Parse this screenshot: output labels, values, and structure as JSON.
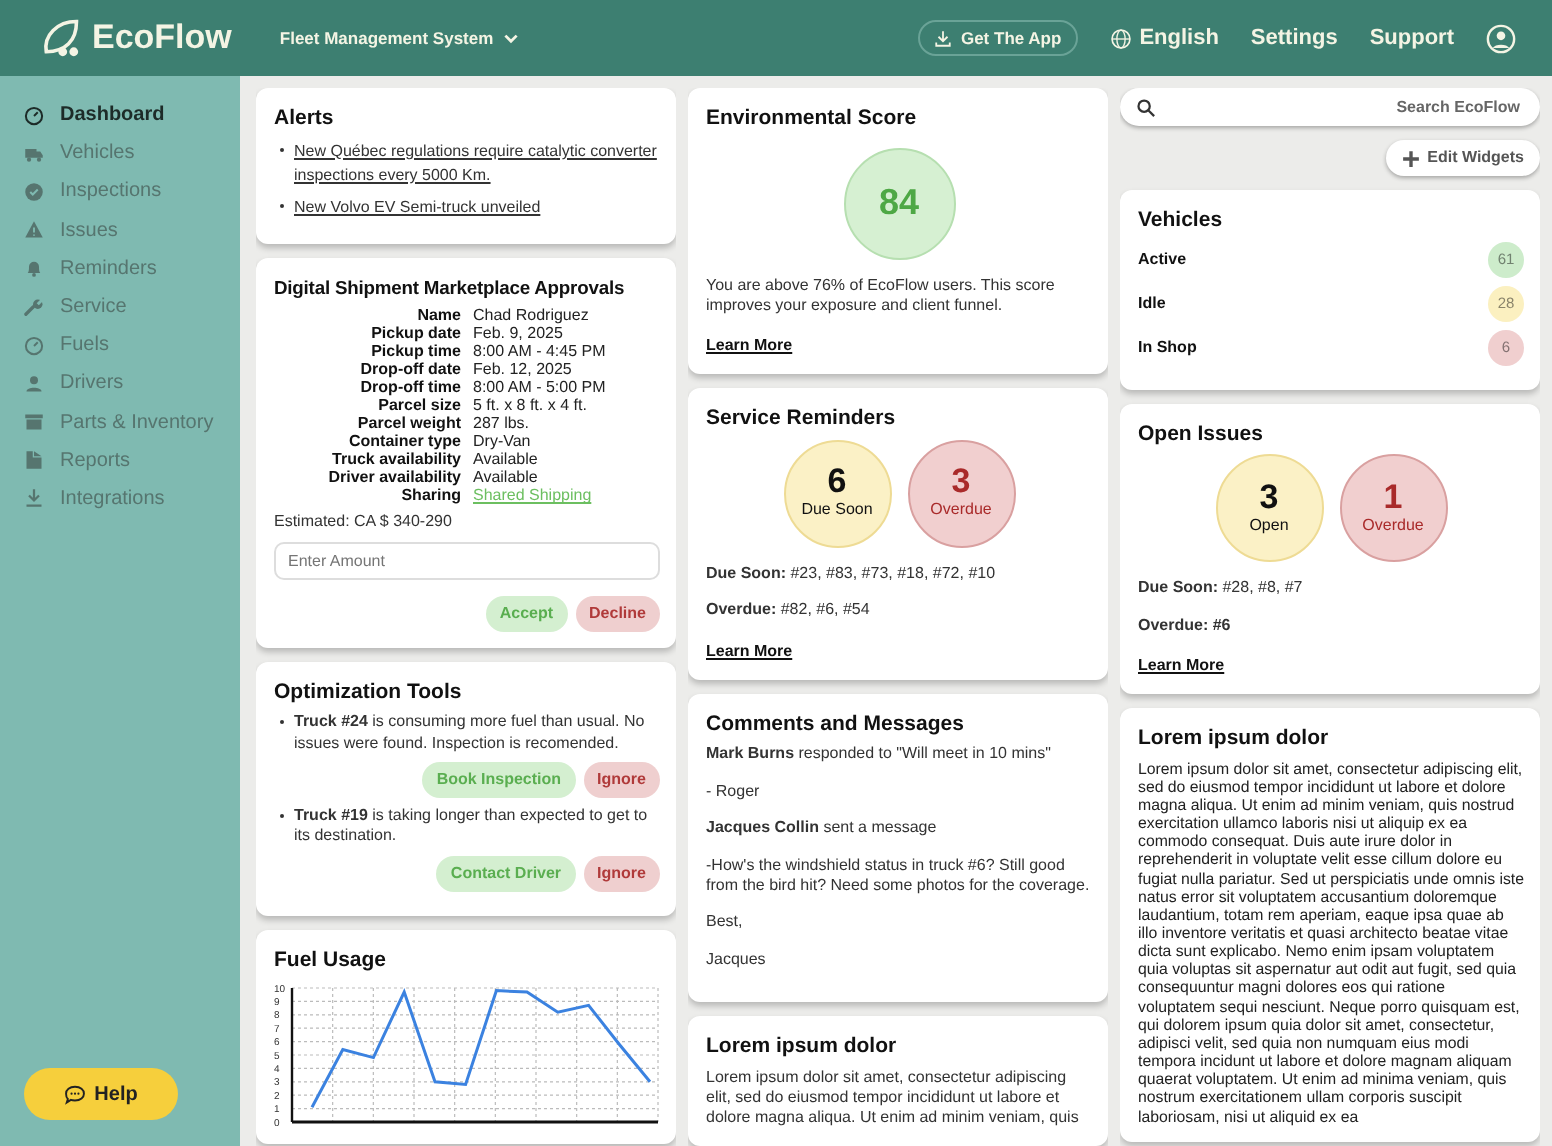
{
  "header": {
    "logo": "EcoFlow",
    "system_menu": "Fleet Management System",
    "get_app": "Get The App",
    "language": "English",
    "links": [
      "Settings",
      "Support"
    ]
  },
  "sidebar": {
    "items": [
      {
        "label": "Dashboard",
        "selected": true
      },
      {
        "label": "Vehicles",
        "selected": false
      },
      {
        "label": "Inspections",
        "selected": false
      },
      {
        "label": "Issues",
        "selected": false
      },
      {
        "label": "Reminders",
        "selected": false
      },
      {
        "label": "Service",
        "selected": false
      },
      {
        "label": "Fuels",
        "selected": false
      },
      {
        "label": "Drivers",
        "selected": false
      },
      {
        "label": "Parts & Inventory",
        "selected": false
      },
      {
        "label": "Reports",
        "selected": false
      },
      {
        "label": "Integrations",
        "selected": false
      }
    ],
    "help": "Help"
  },
  "alerts": {
    "title": "Alerts",
    "items": [
      "New Québec regulations require catalytic converter inspections every 5000 Km.",
      "New Volvo EV Semi-truck unveiled"
    ]
  },
  "approvals": {
    "title": "Digital Shipment Marketplace Approvals",
    "fields": [
      {
        "label": "Name",
        "value": "Chad Rodriguez",
        "kind": "text"
      },
      {
        "label": "Pickup date",
        "value": "Feb. 9, 2025",
        "kind": "text"
      },
      {
        "label": "Pickup time",
        "value": "8:00 AM - 4:45 PM",
        "kind": "text"
      },
      {
        "label": "Drop-off date",
        "value": "Feb. 12, 2025",
        "kind": "text"
      },
      {
        "label": "Drop-off time",
        "value": "8:00 AM - 5:00 PM",
        "kind": "text"
      },
      {
        "label": "Parcel size",
        "value": "5 ft. x 8 ft. x 4 ft.",
        "kind": "text"
      },
      {
        "label": "Parcel weight",
        "value": "287 lbs.",
        "kind": "text"
      },
      {
        "label": "Container type",
        "value": "Dry-Van",
        "kind": "text"
      },
      {
        "label": "Truck availability",
        "value": "Available",
        "kind": "text"
      },
      {
        "label": "Driver availability",
        "value": "Available",
        "kind": "text"
      },
      {
        "label": "Sharing",
        "value": "Shared Shipping",
        "kind": "link"
      }
    ],
    "estimate": "Estimated: CA $ 340-290",
    "amount": {
      "placeholder": "Enter Amount"
    },
    "buttons": [
      {
        "label": "Accept",
        "kind": "accept"
      },
      {
        "label": "Decline",
        "kind": "decline"
      }
    ]
  },
  "optimization": {
    "title": "Optimization Tools",
    "items": [
      {
        "text": "**Truck #24** is consuming more fuel than usual. No issues were found. Inspection is recomended.",
        "buttons": [
          {
            "label": "Book Inspection",
            "kind": "accept"
          },
          {
            "label": "Ignore",
            "kind": "decline"
          }
        ]
      },
      {
        "text": "**Truck #19** is taking longer than expected to get to its destination.",
        "buttons": [
          {
            "label": "Contact Driver",
            "kind": "accept"
          },
          {
            "label": "Ignore",
            "kind": "decline"
          }
        ]
      }
    ]
  },
  "fuel_usage": {
    "title": "Fuel Usage",
    "chart_data": {
      "type": "line",
      "grid": true,
      "ylim": [
        0,
        10
      ],
      "yticks": [
        0,
        1,
        2,
        3,
        4,
        5,
        6,
        7,
        8,
        9,
        10
      ],
      "series": [
        {
          "color": "#3b82e0",
          "values": [
            1.1,
            5.4,
            4.8,
            9.7,
            3.0,
            2.8,
            9.8,
            9.7,
            8.2,
            8.7,
            5.8,
            3.0
          ]
        }
      ]
    }
  },
  "environmental_score": {
    "title": "Environmental Score",
    "score": "84",
    "text": "You are above 76% of EcoFlow users. This score improves your exposure and client funnel.",
    "link": "Learn More"
  },
  "service_reminders": {
    "title": "Service Reminders",
    "counters": [
      {
        "value": "6",
        "label": "Due Soon",
        "kind": "pending"
      },
      {
        "value": "3",
        "label": "Overdue",
        "kind": "overdue"
      }
    ],
    "lines": [
      "**Due Soon:** #23, #83, #73, #18, #72, #10",
      "**Overdue:** #82, #6, #54"
    ],
    "link": "Learn More"
  },
  "comments": {
    "title": "Comments and Messages",
    "paragraphs": [
      "**Mark Burns** responded to \"Will meet in 10 mins\"",
      "- Roger",
      "**Jacques Collin** sent a message",
      "-How's the windshield status in truck #6? Still good from the bird hit? Need some photos for the coverage.",
      "Best,",
      "Jacques"
    ]
  },
  "lorem_middle": {
    "title": "Lorem ipsum dolor",
    "text": "Lorem ipsum dolor sit amet, consectetur adipiscing elit, sed do eiusmod tempor incididunt ut labore et dolore magna aliqua. Ut enim ad minim veniam, quis"
  },
  "search": {
    "placeholder": "Search EcoFlow"
  },
  "edit_widgets": "Edit Widgets",
  "vehicles": {
    "title": "Vehicles",
    "rows": [
      {
        "label": "Active",
        "count": "61",
        "color": "#cdeccb"
      },
      {
        "label": "Idle",
        "count": "28",
        "color": "#fbf0c0"
      },
      {
        "label": "In Shop",
        "count": "6",
        "color": "#f0cfcf"
      }
    ]
  },
  "open_issues": {
    "title": "Open Issues",
    "counters": [
      {
        "value": "3",
        "label": "Open",
        "kind": "pending"
      },
      {
        "value": "1",
        "label": "Overdue",
        "kind": "overdue"
      }
    ],
    "lines": [
      "**Due Soon:** #28, #8, #7",
      "**Overdue: #6**"
    ],
    "link": "Learn More"
  },
  "lorem_right": {
    "title": "Lorem ipsum dolor",
    "text": "Lorem ipsum dolor sit amet, consectetur adipiscing elit, sed do eiusmod tempor incididunt ut labore et dolore magna aliqua. Ut enim ad minim veniam, quis nostrud exercitation ullamco laboris nisi ut aliquip ex ea commodo consequat. Duis aute irure dolor in reprehenderit in voluptate velit esse cillum dolore eu fugiat nulla pariatur. Sed ut perspiciatis unde omnis iste natus error sit voluptatem accusantium doloremque laudantium, totam rem aperiam, eaque ipsa quae ab illo inventore veritatis et quasi architecto beatae vitae dicta sunt explicabo. Nemo enim ipsam voluptatem quia voluptas sit aspernatur aut odit aut fugit, sed quia consequuntur magni dolores eos qui ratione voluptatem sequi nesciunt. Neque porro quisquam est, qui dolorem ipsum quia dolor sit amet, consectetur, adipisci velit, sed quia non numquam eius modi tempora incidunt ut labore et dolore magnam aliquam quaerat voluptatem. Ut enim ad minima veniam, quis nostrum exercitationem ullam corporis suscipit laboriosam, nisi ut aliquid ex ea"
  }
}
